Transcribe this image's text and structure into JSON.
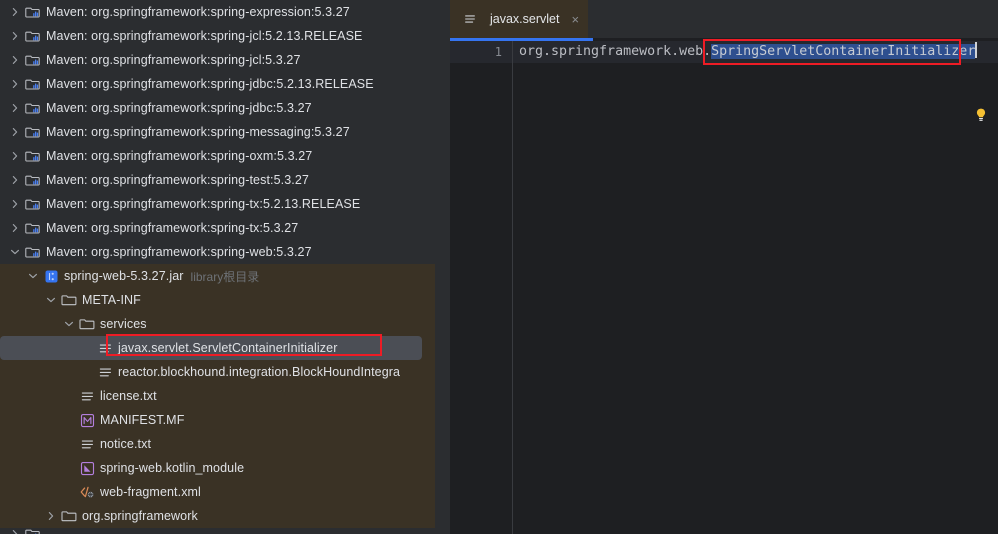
{
  "theme": {
    "background": "#2b2d30",
    "editor_background": "#1e1f22",
    "jar_highlight": "#3a3225",
    "selection_gray": "#4b4e55",
    "selection_blue": "#2e4f8f",
    "accent_blue": "#3574f0",
    "annotation_red": "#ee1c25",
    "text": "#dfe1e5",
    "muted_text": "#6e7277"
  },
  "project_tree": {
    "name": "project-tree",
    "rows": [
      {
        "label": "Maven: org.springframework:spring-expression:5.3.27",
        "icon": "maven-library-icon",
        "indent": 0,
        "arrow": "collapsed",
        "state": "normal"
      },
      {
        "label": "Maven: org.springframework:spring-jcl:5.2.13.RELEASE",
        "icon": "maven-library-icon",
        "indent": 0,
        "arrow": "collapsed",
        "state": "normal"
      },
      {
        "label": "Maven: org.springframework:spring-jcl:5.3.27",
        "icon": "maven-library-icon",
        "indent": 0,
        "arrow": "collapsed",
        "state": "normal"
      },
      {
        "label": "Maven: org.springframework:spring-jdbc:5.2.13.RELEASE",
        "icon": "maven-library-icon",
        "indent": 0,
        "arrow": "collapsed",
        "state": "normal"
      },
      {
        "label": "Maven: org.springframework:spring-jdbc:5.3.27",
        "icon": "maven-library-icon",
        "indent": 0,
        "arrow": "collapsed",
        "state": "normal"
      },
      {
        "label": "Maven: org.springframework:spring-messaging:5.3.27",
        "icon": "maven-library-icon",
        "indent": 0,
        "arrow": "collapsed",
        "state": "normal"
      },
      {
        "label": "Maven: org.springframework:spring-oxm:5.3.27",
        "icon": "maven-library-icon",
        "indent": 0,
        "arrow": "collapsed",
        "state": "normal"
      },
      {
        "label": "Maven: org.springframework:spring-test:5.3.27",
        "icon": "maven-library-icon",
        "indent": 0,
        "arrow": "collapsed",
        "state": "normal"
      },
      {
        "label": "Maven: org.springframework:spring-tx:5.2.13.RELEASE",
        "icon": "maven-library-icon",
        "indent": 0,
        "arrow": "collapsed",
        "state": "normal"
      },
      {
        "label": "Maven: org.springframework:spring-tx:5.3.27",
        "icon": "maven-library-icon",
        "indent": 0,
        "arrow": "collapsed",
        "state": "normal"
      },
      {
        "label": "Maven: org.springframework:spring-web:5.3.27",
        "icon": "maven-library-icon",
        "indent": 0,
        "arrow": "expanded",
        "state": "normal"
      },
      {
        "label": "spring-web-5.3.27.jar",
        "sub_label": "library根目录",
        "icon": "jar-icon",
        "indent": 1,
        "arrow": "expanded",
        "state": "in-jar"
      },
      {
        "label": "META-INF",
        "icon": "folder-icon",
        "indent": 2,
        "arrow": "expanded",
        "state": "in-jar"
      },
      {
        "label": "services",
        "icon": "folder-icon",
        "indent": 3,
        "arrow": "expanded",
        "state": "in-jar"
      },
      {
        "label": "javax.servlet.ServletContainerInitializer",
        "icon": "text-file-icon",
        "indent": 4,
        "arrow": "none",
        "state": "selected"
      },
      {
        "label": "reactor.blockhound.integration.BlockHoundIntegra",
        "icon": "text-file-icon",
        "indent": 4,
        "arrow": "none",
        "state": "in-jar"
      },
      {
        "label": "license.txt",
        "icon": "text-file-icon",
        "indent": 3,
        "arrow": "none",
        "state": "in-jar"
      },
      {
        "label": "MANIFEST.MF",
        "icon": "manifest-icon",
        "indent": 3,
        "arrow": "none",
        "state": "in-jar"
      },
      {
        "label": "notice.txt",
        "icon": "text-file-icon",
        "indent": 3,
        "arrow": "none",
        "state": "in-jar"
      },
      {
        "label": "spring-web.kotlin_module",
        "icon": "kotlin-icon",
        "indent": 3,
        "arrow": "none",
        "state": "in-jar"
      },
      {
        "label": "web-fragment.xml",
        "icon": "xml-icon",
        "indent": 3,
        "arrow": "none",
        "state": "in-jar"
      },
      {
        "label": "org.springframework",
        "icon": "folder-icon",
        "indent": 2,
        "arrow": "collapsed",
        "state": "in-jar"
      },
      {
        "label": "",
        "icon": "maven-library-icon",
        "indent": 0,
        "arrow": "collapsed",
        "state": "clipped"
      }
    ]
  },
  "editor": {
    "name": "code-editor",
    "tab": {
      "title": "javax.servlet",
      "icon": "text-file-icon",
      "close_label": "×",
      "active": true
    },
    "line_number": "1",
    "code_prefix": "org.springframework.web.",
    "code_selected": "SpringServletContainerInitializer",
    "intention_bulb": "lightbulb-icon"
  },
  "annotations": [
    {
      "name": "tree-selection-highlight",
      "shape": "rectangle",
      "color": "#ee1c25"
    },
    {
      "name": "code-selection-highlight",
      "shape": "rectangle",
      "color": "#ee1c25"
    }
  ]
}
